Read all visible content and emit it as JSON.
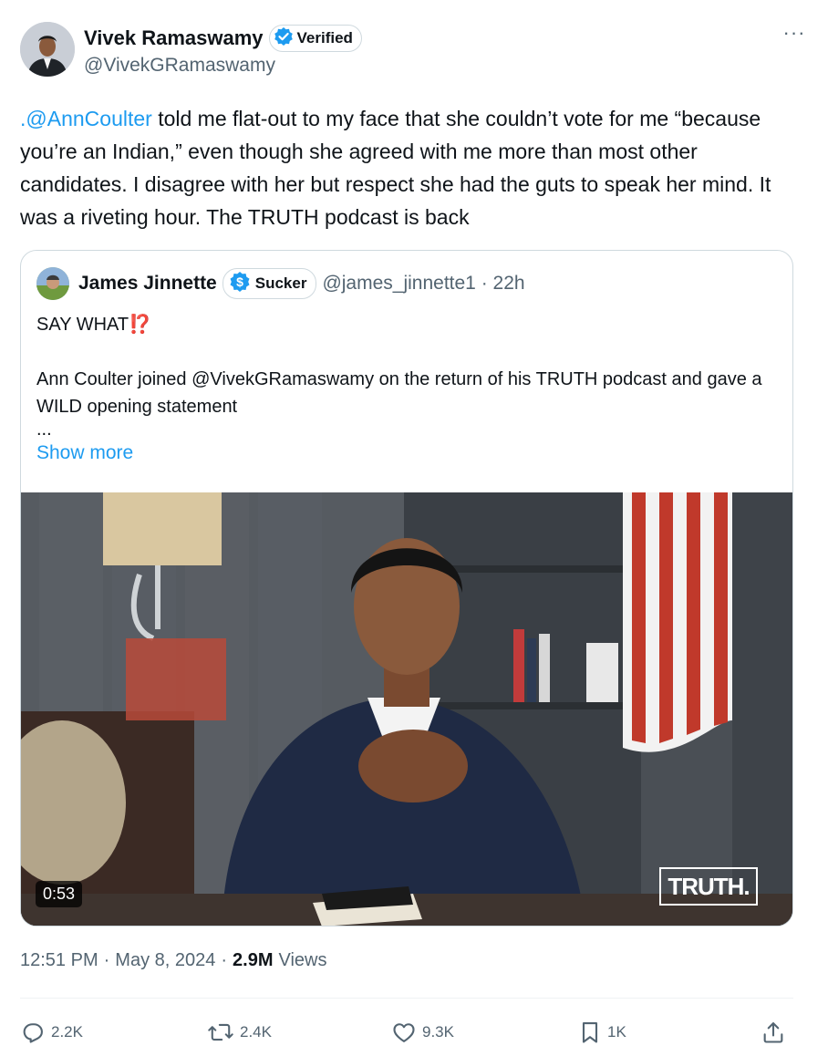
{
  "author": {
    "name": "Vivek Ramaswamy",
    "badge_label": "Verified",
    "handle": "@VivekGRamaswamy"
  },
  "tweet": {
    "mention": ".@AnnCoulter",
    "text_after_mention": " told me flat-out to my face that she couldn’t vote for me “because you’re an Indian,” even though she agreed with me more than most other candidates. I disagree with her but respect she had the guts to speak her mind. It was a riveting hour. The TRUTH podcast is back"
  },
  "quote": {
    "name": "James Jinnette",
    "badge_label": "Sucker",
    "handle_time": "@james_jinnette1 · 22h",
    "line1": "SAY WHAT",
    "line1_emoji": "⁉️",
    "line2": "Ann Coulter joined @VivekGRamaswamy on the return of his TRUTH podcast and gave a WILD opening statement",
    "line3": "...",
    "show_more": "Show more",
    "video": {
      "duration": "0:53",
      "logo_text": "TRUTH."
    }
  },
  "meta": {
    "time": "12:51 PM",
    "sep1": "·",
    "date": "May 8, 2024",
    "sep2": "·",
    "views_count": "2.9M",
    "views_label": "Views"
  },
  "actions": {
    "reply_count": "2.2K",
    "retweet_count": "2.4K",
    "like_count": "9.3K",
    "bookmark_count": "1K"
  },
  "colors": {
    "accent": "#1d9bf0",
    "text": "#0f1419",
    "muted": "#536471",
    "border": "#cfd9de"
  }
}
